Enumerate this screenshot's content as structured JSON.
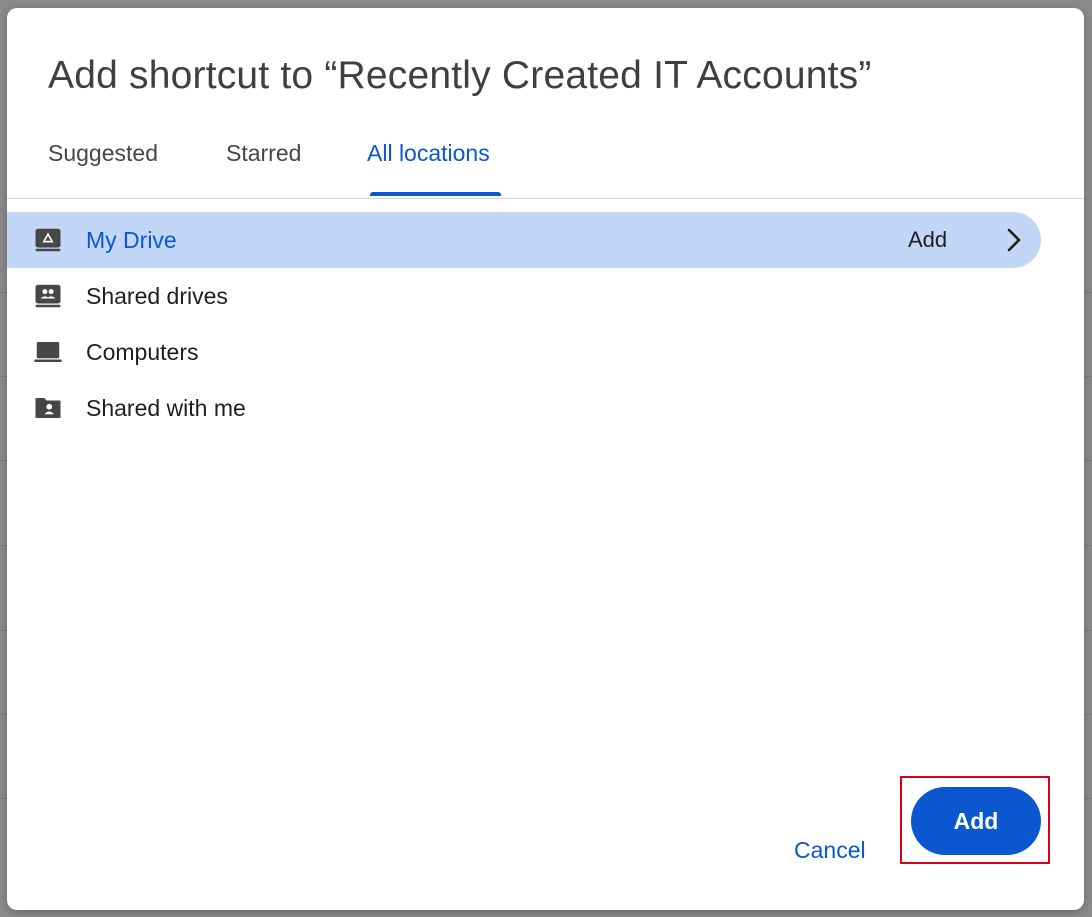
{
  "dialog": {
    "title": "Add shortcut to “Recently Created IT Accounts”",
    "tabs": [
      {
        "label": "Suggested",
        "active": false
      },
      {
        "label": "Starred",
        "active": false
      },
      {
        "label": "All locations",
        "active": true
      }
    ],
    "locations": [
      {
        "label": "My Drive",
        "icon": "my-drive-icon",
        "selected": true,
        "add_label": "Add"
      },
      {
        "label": "Shared drives",
        "icon": "shared-drives-icon",
        "selected": false
      },
      {
        "label": "Computers",
        "icon": "computer-icon",
        "selected": false
      },
      {
        "label": "Shared with me",
        "icon": "shared-with-me-icon",
        "selected": false
      }
    ],
    "actions": {
      "cancel_label": "Cancel",
      "add_label": "Add"
    }
  },
  "colors": {
    "accent": "#0b57d0",
    "selected_row": "#c2d7f7",
    "highlight_box": "#d6001c",
    "text_primary": "#1f1f1f"
  }
}
